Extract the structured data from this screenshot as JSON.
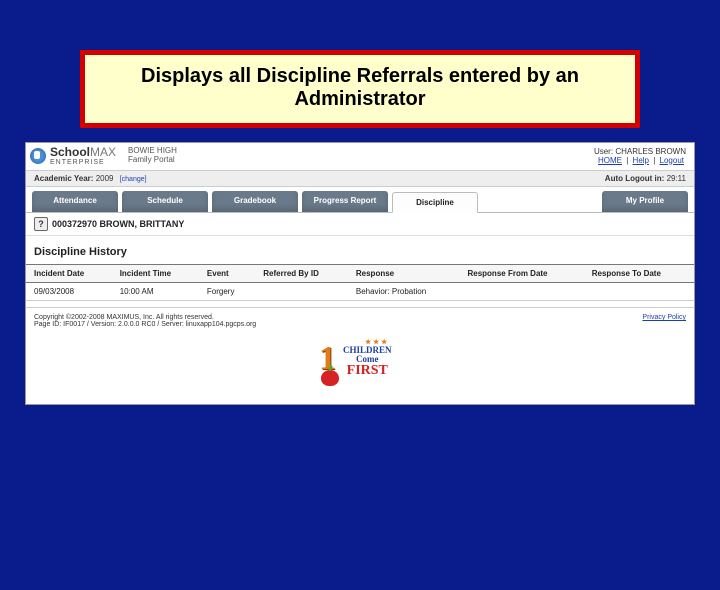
{
  "callout": "Displays all Discipline Referrals entered by an Administrator",
  "brand": {
    "name_a": "School",
    "name_b": "MAX",
    "sub": "ENTERPRISE"
  },
  "portal": {
    "line1": "BOWIE HIGH",
    "line2": "Family Portal"
  },
  "user": {
    "label": "User:",
    "name": "CHARLES BROWN",
    "home": "HOME",
    "help": "Help",
    "logout": "Logout"
  },
  "yearbar": {
    "label": "Academic Year:",
    "value": "2009",
    "change": "[change]",
    "auto_label": "Auto Logout in:",
    "auto_value": "29:11"
  },
  "tabs": [
    "Attendance",
    "Schedule",
    "Gradebook",
    "Progress Report",
    "Discipline",
    "My Profile"
  ],
  "active_tab": 4,
  "student": {
    "id_name": "000372970 BROWN, BRITTANY"
  },
  "section_title": "Discipline History",
  "table": {
    "headers": [
      "Incident Date",
      "Incident Time",
      "Event",
      "Referred By ID",
      "Response",
      "Response From Date",
      "Response To Date"
    ],
    "rows": [
      {
        "cells": [
          "09/03/2008",
          "10:00 AM",
          "Forgery",
          "",
          "Behavior: Probation",
          "",
          ""
        ]
      }
    ]
  },
  "footer": {
    "copyright": "Copyright ©2002-2008 MAXIMUS, Inc. All rights reserved.",
    "pageinfo": "Page ID: IF0017 / Version: 2.0.0.0 RC0 / Server: linuxapp104.pgcps.org",
    "privacy": "Privacy Policy"
  },
  "logo": {
    "children": "CHILDREN",
    "come": "Come",
    "first": "FIRST"
  }
}
